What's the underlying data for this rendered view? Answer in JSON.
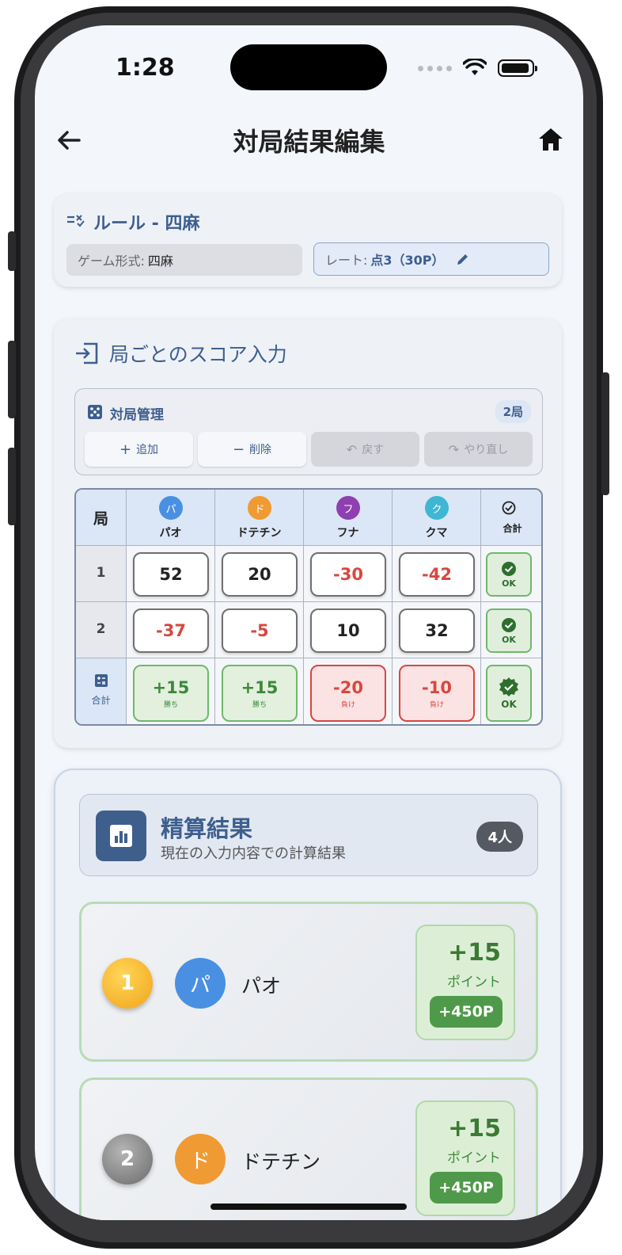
{
  "status": {
    "time": "1:28"
  },
  "nav": {
    "title": "対局結果編集"
  },
  "rule": {
    "title": "ルール - 四麻",
    "game_key": "ゲーム形式:",
    "game_value": "四麻",
    "rate_key": "レート:",
    "rate_value": "点3（30P）"
  },
  "score_section": {
    "title": "局ごとのスコア入力",
    "management": {
      "title": "対局管理",
      "rounds_badge": "2局",
      "buttons": [
        {
          "label": "追加",
          "icon": "plus-icon",
          "enabled": true
        },
        {
          "label": "削除",
          "icon": "minus-icon",
          "enabled": true
        },
        {
          "label": "戻す",
          "icon": "undo-icon",
          "enabled": false
        },
        {
          "label": "やり直し",
          "icon": "redo-icon",
          "enabled": false
        }
      ]
    },
    "table": {
      "round_header": "局",
      "total_header": "合計",
      "players": [
        {
          "initial": "パ",
          "name": "パオ",
          "color": "#4a90e2"
        },
        {
          "initial": "ド",
          "name": "ドテチン",
          "color": "#f09a34"
        },
        {
          "initial": "フ",
          "name": "フナ",
          "color": "#8e3fb0"
        },
        {
          "initial": "ク",
          "name": "クマ",
          "color": "#3fb6d4"
        }
      ],
      "rounds": [
        {
          "no": "1",
          "scores": [
            "52",
            "20",
            "-30",
            "-42"
          ],
          "check": "OK"
        },
        {
          "no": "2",
          "scores": [
            "-37",
            "-5",
            "10",
            "32"
          ],
          "check": "OK"
        }
      ],
      "totals": {
        "label": "合計",
        "values": [
          {
            "value": "+15",
            "status": "勝ち"
          },
          {
            "value": "+15",
            "status": "勝ち"
          },
          {
            "value": "-20",
            "status": "負け"
          },
          {
            "value": "-10",
            "status": "負け"
          }
        ],
        "check": "OK"
      }
    }
  },
  "results": {
    "title": "精算結果",
    "subtitle": "現在の入力内容での計算結果",
    "count_badge": "4人",
    "points_label": "ポイント",
    "rankings": [
      {
        "rank": "1",
        "initial": "パ",
        "name": "パオ",
        "points": "+15",
        "money": "+450P",
        "rank_color": "#f3b41e",
        "avatar_color": "#4a90e2"
      },
      {
        "rank": "2",
        "initial": "ド",
        "name": "ドテチン",
        "points": "+15",
        "money": "+450P",
        "rank_color": "#7d7d7d",
        "avatar_color": "#f09a34"
      }
    ]
  }
}
